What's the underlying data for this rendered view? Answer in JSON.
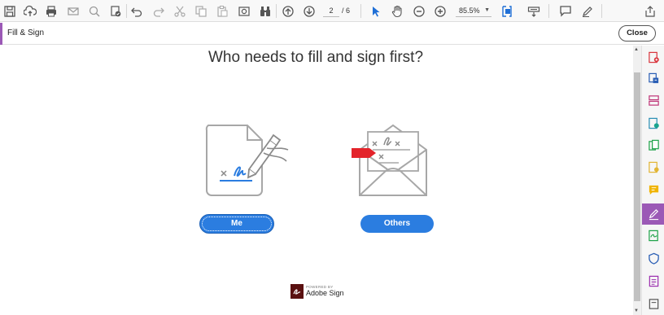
{
  "toolbar": {
    "page_current": "2",
    "page_total": "/ 6",
    "zoom": "85.5%",
    "icons": [
      "save-icon",
      "upload-icon",
      "print-icon",
      "email-icon",
      "search-icon",
      "certified-icon",
      "undo-icon",
      "redo-icon",
      "cut-icon",
      "copy-icon",
      "paste-icon",
      "snapshot-icon",
      "binoculars-icon",
      "prev-page-icon",
      "next-page-icon",
      "select-arrow-icon",
      "hand-icon",
      "zoom-out-icon",
      "zoom-in-icon",
      "fit-page-icon",
      "keyboard-icon",
      "comment-icon",
      "pen-icon",
      "share-icon"
    ]
  },
  "fill_sign_bar": {
    "title": "Fill & Sign",
    "close_label": "Close"
  },
  "main": {
    "heading": "Who needs to fill and sign first?",
    "me_label": "Me",
    "others_label": "Others"
  },
  "powered": {
    "small": "POWERED BY",
    "big": "Adobe Sign"
  },
  "colors": {
    "accent_purple": "#9b59b6",
    "button_blue": "#2b7de0",
    "flag_red": "#e3242b"
  }
}
